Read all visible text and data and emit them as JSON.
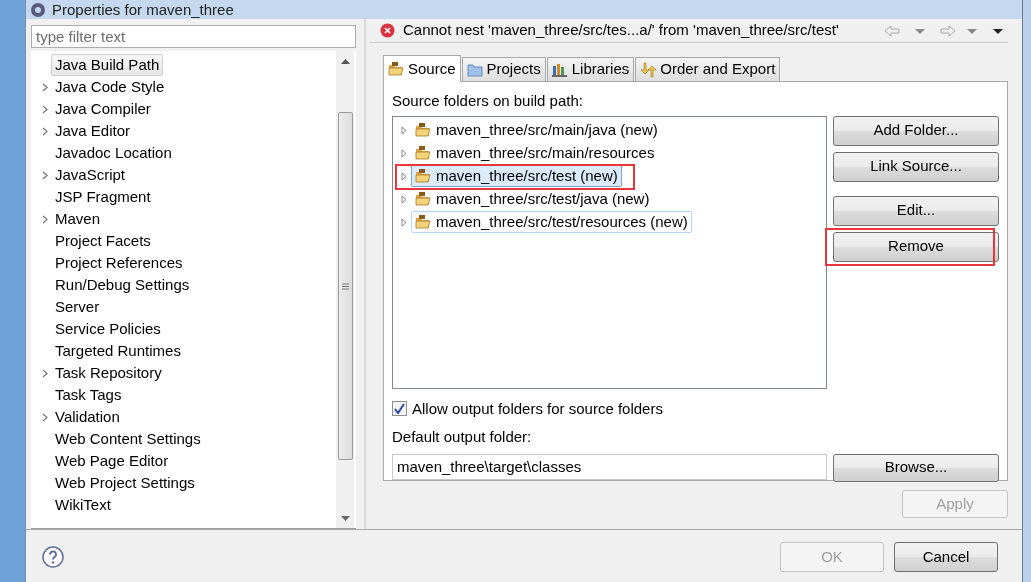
{
  "window": {
    "title": "Properties for maven_three"
  },
  "filter": {
    "placeholder": "type filter text"
  },
  "tree": [
    {
      "label": "Java Build Path",
      "expandable": false,
      "selected": true
    },
    {
      "label": "Java Code Style",
      "expandable": true,
      "selected": false
    },
    {
      "label": "Java Compiler",
      "expandable": true,
      "selected": false
    },
    {
      "label": "Java Editor",
      "expandable": true,
      "selected": false
    },
    {
      "label": "Javadoc Location",
      "expandable": false,
      "selected": false
    },
    {
      "label": "JavaScript",
      "expandable": true,
      "selected": false
    },
    {
      "label": "JSP Fragment",
      "expandable": false,
      "selected": false
    },
    {
      "label": "Maven",
      "expandable": true,
      "selected": false
    },
    {
      "label": "Project Facets",
      "expandable": false,
      "selected": false
    },
    {
      "label": "Project References",
      "expandable": false,
      "selected": false
    },
    {
      "label": "Run/Debug Settings",
      "expandable": false,
      "selected": false
    },
    {
      "label": "Server",
      "expandable": false,
      "selected": false
    },
    {
      "label": "Service Policies",
      "expandable": false,
      "selected": false
    },
    {
      "label": "Targeted Runtimes",
      "expandable": false,
      "selected": false
    },
    {
      "label": "Task Repository",
      "expandable": true,
      "selected": false
    },
    {
      "label": "Task Tags",
      "expandable": false,
      "selected": false
    },
    {
      "label": "Validation",
      "expandable": true,
      "selected": false
    },
    {
      "label": "Web Content Settings",
      "expandable": false,
      "selected": false
    },
    {
      "label": "Web Page Editor",
      "expandable": false,
      "selected": false
    },
    {
      "label": "Web Project Settings",
      "expandable": false,
      "selected": false
    },
    {
      "label": "WikiText",
      "expandable": false,
      "selected": false
    }
  ],
  "error_message": "Cannot nest 'maven_three/src/tes...a/' from 'maven_three/src/test'",
  "tabs": [
    {
      "label": "Source",
      "kind": "source",
      "selected": true
    },
    {
      "label": "Projects",
      "kind": "projects",
      "selected": false
    },
    {
      "label": "Libraries",
      "kind": "libraries",
      "selected": false
    },
    {
      "label": "Order and Export",
      "kind": "order",
      "selected": false
    }
  ],
  "source_label": "Source folders on build path:",
  "source_folders": [
    {
      "label": "maven_three/src/main/java (new)",
      "selected": false,
      "focused": false,
      "annotated": false
    },
    {
      "label": "maven_three/src/main/resources",
      "selected": false,
      "focused": false,
      "annotated": false
    },
    {
      "label": "maven_three/src/test (new)",
      "selected": true,
      "focused": false,
      "annotated": true
    },
    {
      "label": "maven_three/src/test/java (new)",
      "selected": false,
      "focused": false,
      "annotated": false
    },
    {
      "label": "maven_three/src/test/resources (new)",
      "selected": false,
      "focused": true,
      "annotated": false
    }
  ],
  "side_buttons": [
    {
      "label": "Add Folder...",
      "annotated": false
    },
    {
      "label": "Link Source...",
      "annotated": false
    },
    {
      "label": "Edit...",
      "annotated": false
    },
    {
      "label": "Remove",
      "annotated": true
    }
  ],
  "allow_output": {
    "label": "Allow output folders for source folders",
    "checked": true
  },
  "output_label": "Default output folder:",
  "output_value": "maven_three\\target\\classes",
  "browse_button": "Browse...",
  "apply_button": {
    "label": "Apply",
    "disabled": true
  },
  "ok_button": {
    "label": "OK",
    "disabled": true
  },
  "cancel_button": {
    "label": "Cancel",
    "disabled": false
  }
}
